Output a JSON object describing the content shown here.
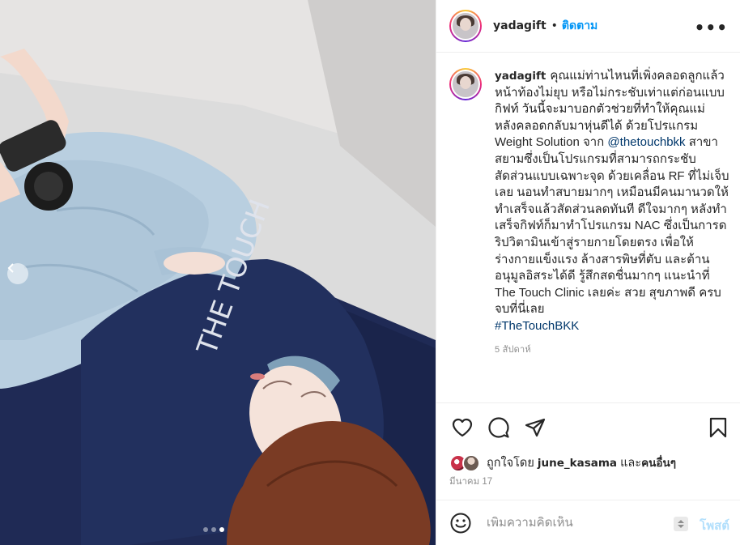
{
  "post": {
    "username": "yadagift",
    "separator": "•",
    "follow_label": "ติดตาม",
    "more_icon": "more-horizontal-icon",
    "more_label": "•••"
  },
  "photo": {
    "brand_text": "THE TOUCH",
    "carousel": {
      "total": 3,
      "active_index": 3
    }
  },
  "caption": {
    "username": "yadagift",
    "text_1": "คุณแม่ท่านไหนที่เพิ่งคลอดลูกแล้วหน้าท้องไม่ยุบ หรือไม่กระชับเท่าแต่ก่อนแบบกิฟท์ วันนี้จะมาบอกตัวช่วยที่ทำให้คุณแม่หลังคลอดกลับมาหุ่นดีได้ ด้วยโปรแกรม Weight Solution จาก ",
    "mention": "@thetouchbkk",
    "text_2": " สาขาสยามซึ่งเป็นโปรแกรมที่สามารถกระชับสัดส่วนแบบเฉพาะจุด ด้วยเคลื่อน RF ที่ไม่เจ็บเลย นอนทำสบายมากๆ เหมือนมีคนมานวดให้ ทำเสร็จแล้วสัดส่วนลดทันที ดีใจมากๆ หลังทำเสร็จกิฟท์ก็มาทำโปรแกรม NAC ซึ่งเป็นการดริปวิตามินเข้าสู่รายกายโดยตรง เพื่อให้ร่างกายแข็งแรง ล้างสารพิษที่ตับ และต้านอนุมูลอิสระได้ดี รู้สึกสดชื่นมากๆ แนะนำที่ The Touch Clinic เลยค่ะ สวย สุขภาพดี ครบจบที่นี่เลย",
    "hashtag": "#TheTouchBKK",
    "time": "5 สัปดาห์"
  },
  "actions": {
    "like_icon": "heart-icon",
    "comment_icon": "comment-icon",
    "share_icon": "share-icon",
    "save_icon": "bookmark-icon"
  },
  "likes": {
    "prefix": "ถูกใจโดย",
    "user": "june_kasama",
    "conj": "และ",
    "others": "คนอื่นๆ"
  },
  "date": "มีนาคม 17",
  "comment_box": {
    "placeholder": "เพิ่มความคิดเห็น",
    "post_label": "โพสต์",
    "emoji_icon": "smiley-icon"
  }
}
